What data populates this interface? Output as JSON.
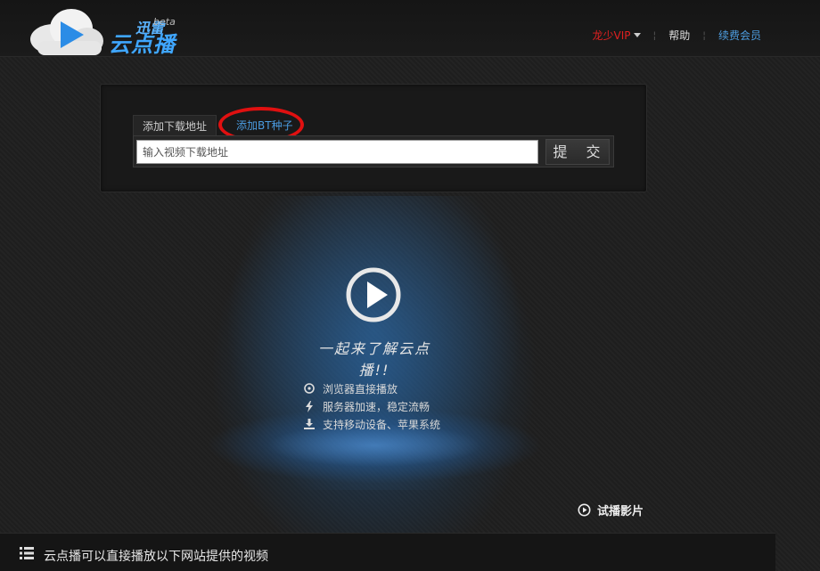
{
  "header": {
    "logo_top": "迅雷",
    "logo_main": "云点播",
    "logo_beta": "beta",
    "nav": {
      "vip_label": "龙少VIP",
      "separator": "¦",
      "help_label": "帮助",
      "renew_label": "续费会员"
    }
  },
  "panel": {
    "tabs": [
      {
        "label": "添加下载地址"
      },
      {
        "label": "添加BT种子"
      }
    ],
    "url_input_placeholder": "输入视频下载地址",
    "submit_label": "提 交"
  },
  "hero": {
    "slogan": "一起来了解云点播!!",
    "features": [
      {
        "icon": "browser-icon",
        "text": "浏览器直接播放"
      },
      {
        "icon": "lightning-icon",
        "text": "服务器加速，稳定流畅"
      },
      {
        "icon": "download-icon",
        "text": "支持移动设备、苹果系统"
      }
    ],
    "trial_label": "试播影片"
  },
  "footer": {
    "text": "云点播可以直接播放以下网站提供的视频"
  },
  "colors": {
    "accent_blue": "#4a9be0",
    "vip_red": "#e02020",
    "annotation_red": "#e01010"
  }
}
